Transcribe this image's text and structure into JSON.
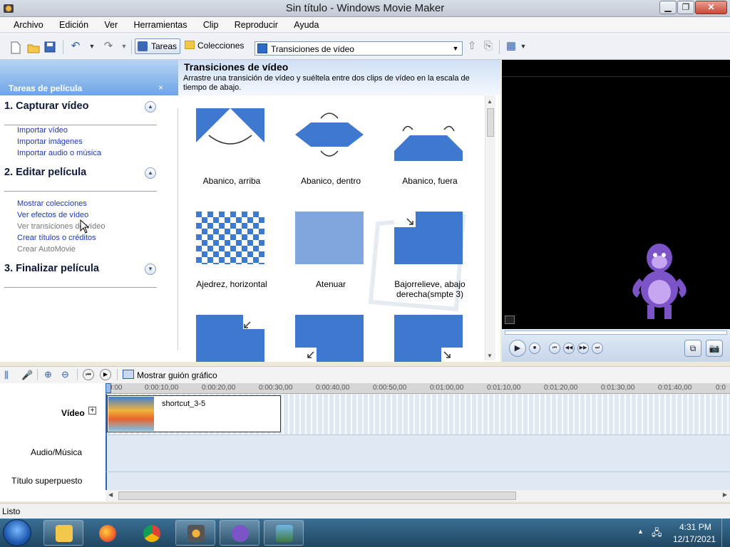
{
  "window": {
    "title": "Sin título - Windows Movie Maker"
  },
  "menu": [
    "Archivo",
    "Edición",
    "Ver",
    "Herramientas",
    "Clip",
    "Reproducir",
    "Ayuda"
  ],
  "toolbar": {
    "tasks_label": "Tareas",
    "collections_label": "Colecciones",
    "view_select_value": "Transiciones de vídeo"
  },
  "tasks_pane": {
    "header": "Tareas de película",
    "close": "×",
    "sections": [
      {
        "title": "1. Capturar vídeo",
        "expanded": true,
        "links": [
          {
            "label": "Importar vídeo",
            "enabled": true
          },
          {
            "label": "Importar imágenes",
            "enabled": true
          },
          {
            "label": "Importar audio o música",
            "enabled": true
          }
        ]
      },
      {
        "title": "2. Editar película",
        "expanded": true,
        "links": [
          {
            "label": "Mostrar colecciones",
            "enabled": true
          },
          {
            "label": "Ver efectos de vídeo",
            "enabled": true
          },
          {
            "label": "Ver transiciones de vídeo",
            "enabled": false
          },
          {
            "label": "Crear títulos o créditos",
            "enabled": true
          },
          {
            "label": "Crear AutoMovie",
            "enabled": false
          }
        ]
      },
      {
        "title": "3. Finalizar película",
        "expanded": false,
        "links": []
      }
    ]
  },
  "content": {
    "title": "Transiciones de vídeo",
    "description": "Arrastre una transición de vídeo y suéltela entre dos clips de vídeo en la escala de tiempo de abajo.",
    "transitions": [
      "Abanico, arriba",
      "Abanico, dentro",
      "Abanico, fuera",
      "Ajedrez, horizontal",
      "Atenuar",
      "Bajorrelieve, abajo derecha(smpte 3)"
    ]
  },
  "timeline": {
    "storyboard_label": "Mostrar guión gráfico",
    "ruler": [
      "0:00",
      "0:00:10,00",
      "0:00:20,00",
      "0:00:30,00",
      "0:00:40,00",
      "0:00:50,00",
      "0:01:00,00",
      "0:01:10,00",
      "0:01:20,00",
      "0:01:30,00",
      "0:01:40,00",
      "0:0"
    ],
    "tracks": {
      "video": "Vídeo",
      "audio": "Audio/Música",
      "title_overlay": "Título superpuesto"
    },
    "clip_name": "shortcut_3-5"
  },
  "status": {
    "text": "Listo"
  },
  "taskbar": {
    "time": "4:31 PM",
    "date": "12/17/2021"
  }
}
